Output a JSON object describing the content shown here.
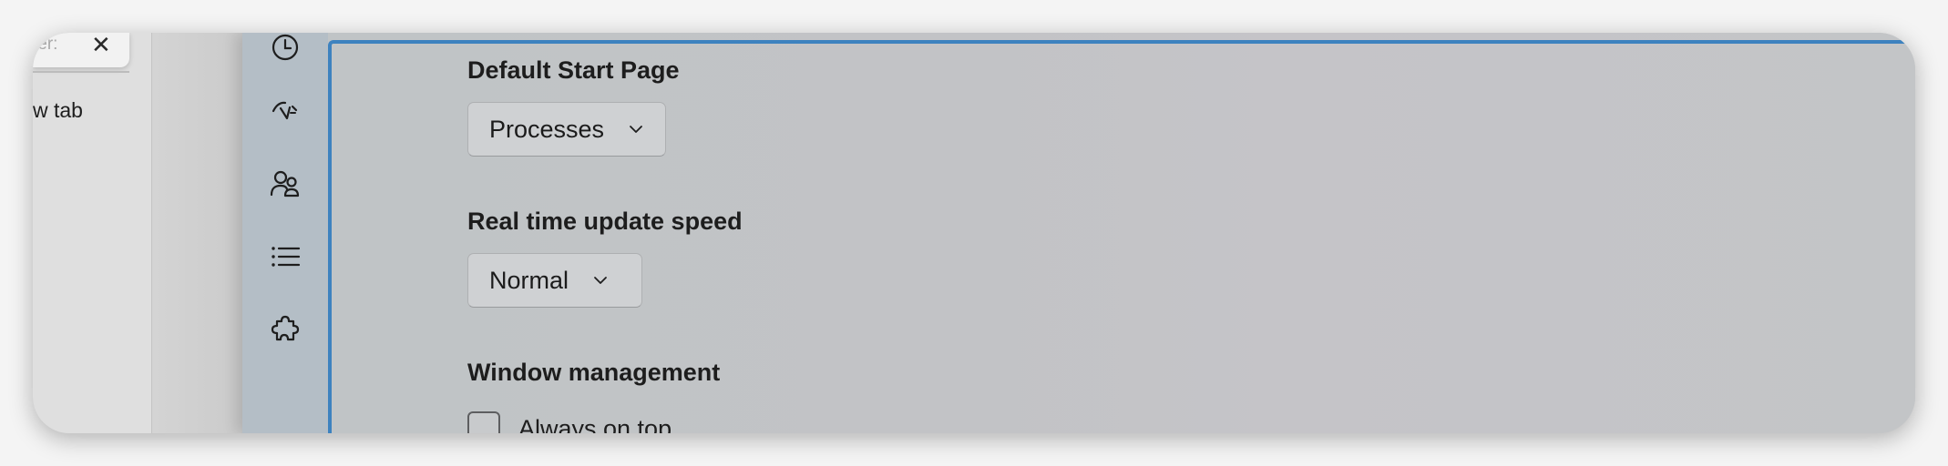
{
  "background_browser": {
    "tab_fragment": "ter:",
    "new_tab_fragment": "w tab"
  },
  "nav_rail": {
    "items": [
      {
        "icon": "clock-history-icon"
      },
      {
        "icon": "startup-speedometer-icon"
      },
      {
        "icon": "users-icon"
      },
      {
        "icon": "details-list-icon"
      },
      {
        "icon": "services-puzzle-icon"
      }
    ]
  },
  "settings": {
    "default_start_page": {
      "label": "Default Start Page",
      "value": "Processes"
    },
    "update_speed": {
      "label": "Real time update speed",
      "value": "Normal"
    },
    "window_management": {
      "label": "Window management",
      "always_on_top": {
        "label": "Always on top",
        "checked": false
      }
    }
  },
  "colors": {
    "accent": "#3d82bf",
    "nav_rail": "#b4bec6",
    "content_bg": "#c2c4c6"
  }
}
